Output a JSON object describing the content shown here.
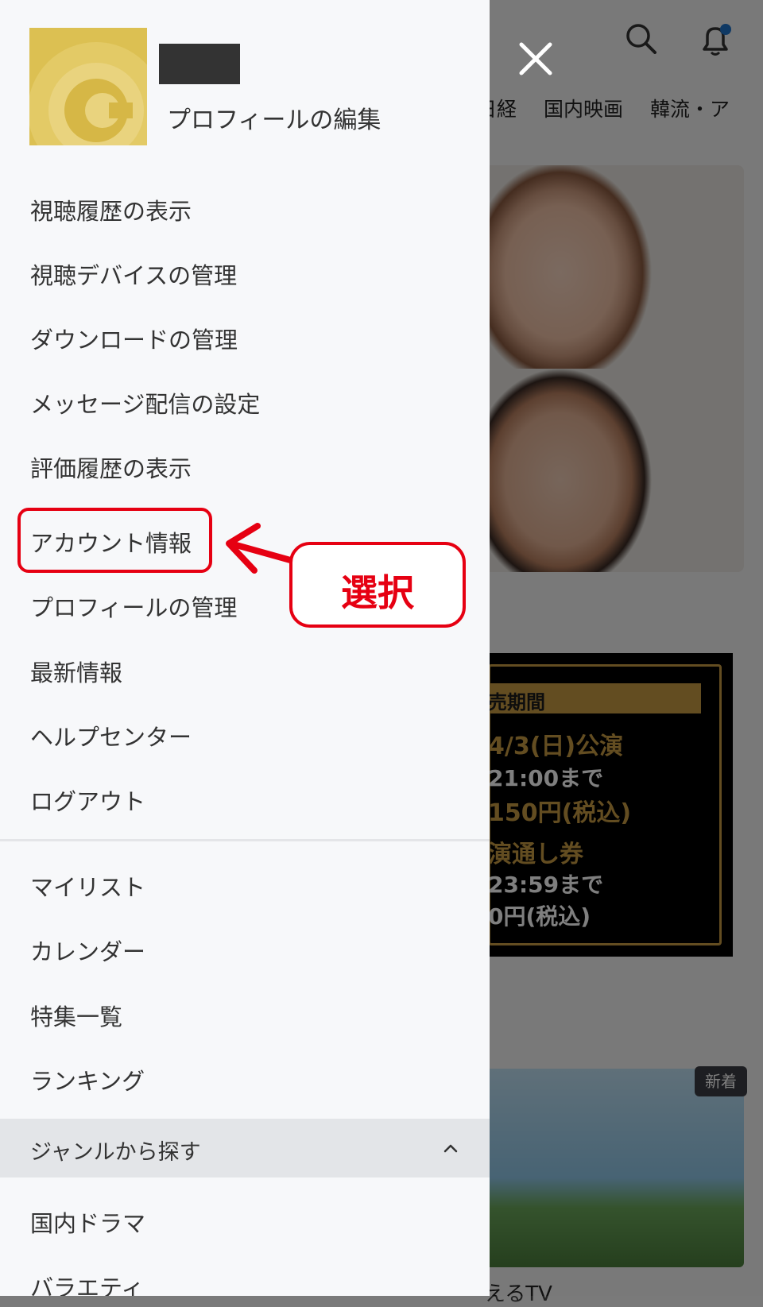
{
  "background": {
    "tabs": [
      "日経",
      "国内映画",
      "韓流・ア"
    ],
    "ticket_card": {
      "header": "売期間",
      "lines": [
        "4/3(日)公演",
        "21:00まで",
        "150円(税込)",
        "演通し券",
        "23:59まで",
        "0円(税込)"
      ]
    },
    "badge_new": "新着",
    "bottom_text": "えるTV"
  },
  "drawer": {
    "profile_edit_label": "プロフィールの編集",
    "menu_items": [
      "視聴履歴の表示",
      "視聴デバイスの管理",
      "ダウンロードの管理",
      "メッセージ配信の設定",
      "評価履歴の表示",
      "アカウント情報",
      "プロフィールの管理",
      "最新情報",
      "ヘルプセンター",
      "ログアウト"
    ],
    "secondary_items": [
      "マイリスト",
      "カレンダー",
      "特集一覧",
      "ランキング"
    ],
    "genre_section_label": "ジャンルから探す",
    "genre_items": [
      "国内ドラマ",
      "バラエティ"
    ]
  },
  "annotation": {
    "callout_text": "選択",
    "highlight_color": "#e60012"
  },
  "colors": {
    "drawer_bg": "#f7f8fa",
    "gold": "#c79a43",
    "notification_dot": "#1f73c8"
  }
}
